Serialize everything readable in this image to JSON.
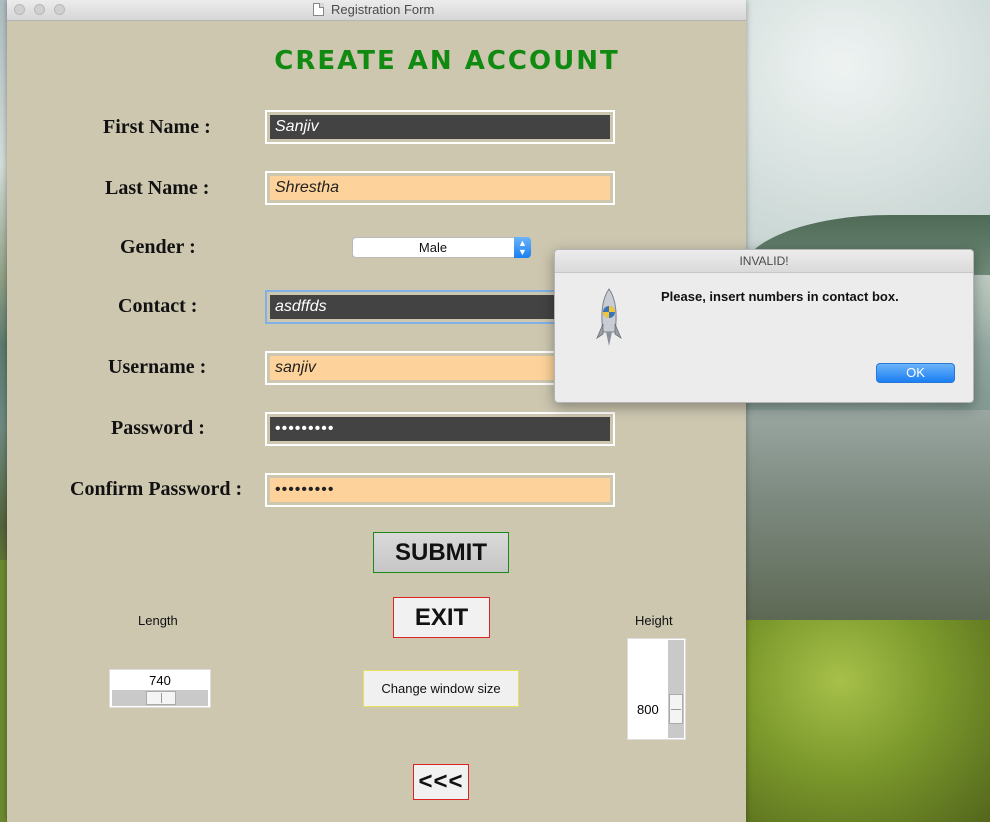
{
  "window": {
    "title": "Registration Form"
  },
  "heading": "CREATE AN ACCOUNT",
  "form": {
    "first_name": {
      "label": "First Name :",
      "value": "Sanjiv"
    },
    "last_name": {
      "label": "Last Name :",
      "value": "Shrestha"
    },
    "gender": {
      "label": "Gender :",
      "value": "Male"
    },
    "contact": {
      "label": "Contact :",
      "value": "asdffds"
    },
    "username": {
      "label": "Username :",
      "value": "sanjiv"
    },
    "password": {
      "label": "Password :",
      "value": "•••••••••"
    },
    "confirm_password": {
      "label": "Confirm Password :",
      "value": "•••••••••"
    }
  },
  "buttons": {
    "submit": "SUBMIT",
    "exit": "EXIT",
    "change_size": "Change window size",
    "back": "<<<"
  },
  "length": {
    "label": "Length",
    "value": "740"
  },
  "height": {
    "label": "Height",
    "value": "800"
  },
  "dialog": {
    "title": "INVALID!",
    "message": "Please, insert numbers in contact box.",
    "ok": "OK"
  },
  "colors": {
    "heading": "#108a10",
    "field_dark": "#434343",
    "field_peach": "#fdd39b",
    "window_bg": "#cdc7b0",
    "ok_button": "#1a7ff2"
  },
  "icons": {
    "dialog_icon": "python-rocket-icon",
    "document_icon": "document-icon",
    "select_arrows": "chevron-updown-icon"
  }
}
